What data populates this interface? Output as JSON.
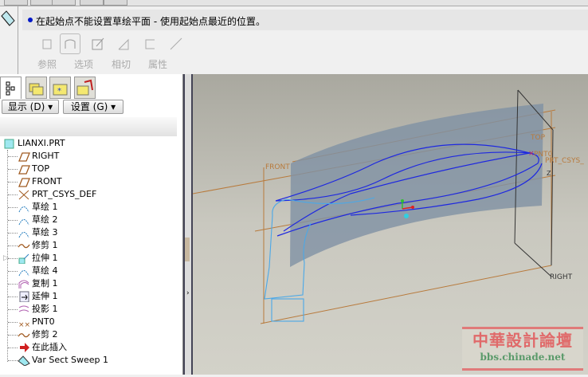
{
  "message": "在起始点不能设置草绘平面 - 使用起始点最近的位置。",
  "dashboard": {
    "tabs": [
      "参照",
      "选项",
      "相切",
      "属性"
    ]
  },
  "panel": {
    "show_button": "显示 (D) ▾",
    "settings_button": "设置 (G) ▾",
    "tree": [
      {
        "label": "LIANXI.PRT",
        "icon": "part-icon"
      },
      {
        "label": "RIGHT",
        "icon": "datum-plane-icon"
      },
      {
        "label": "TOP",
        "icon": "datum-plane-icon"
      },
      {
        "label": "FRONT",
        "icon": "datum-plane-icon"
      },
      {
        "label": "PRT_CSYS_DEF",
        "icon": "csys-icon"
      },
      {
        "label": "草绘 1",
        "icon": "sketch-icon"
      },
      {
        "label": "草绘 2",
        "icon": "sketch-icon"
      },
      {
        "label": "草绘 3",
        "icon": "sketch-icon"
      },
      {
        "label": "修剪 1",
        "icon": "trim-icon"
      },
      {
        "label": "拉伸 1",
        "icon": "extrude-icon"
      },
      {
        "label": "草绘 4",
        "icon": "sketch-icon"
      },
      {
        "label": "复制 1",
        "icon": "copy-icon"
      },
      {
        "label": "延伸 1",
        "icon": "extend-icon"
      },
      {
        "label": "投影 1",
        "icon": "project-icon"
      },
      {
        "label": "PNT0",
        "icon": "datum-point-icon"
      },
      {
        "label": "修剪 2",
        "icon": "trim-icon"
      },
      {
        "label": "在此插入",
        "icon": "insert-here-arrow-icon"
      },
      {
        "label": "Var Sect Sweep 1",
        "icon": "var-sect-sweep-icon"
      }
    ]
  },
  "viewport": {
    "labels": {
      "front": "FRONT",
      "top": "TOP",
      "right": "RIGHT",
      "pnt": "PNT0",
      "csys": "PRT_CSYS_",
      "z": "Z"
    }
  },
  "watermark": {
    "title": "中華設計論壇",
    "url": "bbs.chinade.net"
  },
  "colors": {
    "datum": "#b87a3c",
    "curve": "#1e28e0",
    "surface": "#7f91a4",
    "message_dot": "#0018c8"
  }
}
